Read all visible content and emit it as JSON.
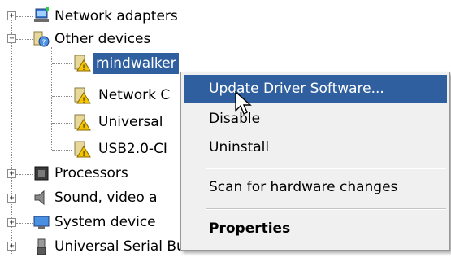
{
  "tree": {
    "nodes": [
      {
        "label": "Network adapters",
        "icon": "network-adapter-icon",
        "expander": "+"
      },
      {
        "label": "Other devices",
        "icon": "unknown-device-icon",
        "expander": "−"
      },
      {
        "label": "mindwalker",
        "icon": "warning-device-icon",
        "selected": true
      },
      {
        "label": "Network C",
        "icon": "warning-device-icon"
      },
      {
        "label": "Universal",
        "icon": "warning-device-icon"
      },
      {
        "label": "USB2.0-CI",
        "icon": "warning-device-icon"
      },
      {
        "label": "Processors",
        "icon": "processor-icon",
        "expander": "+"
      },
      {
        "label": "Sound, video a",
        "icon": "speaker-icon",
        "expander": "+"
      },
      {
        "label": "System device",
        "icon": "system-device-icon",
        "expander": "+"
      },
      {
        "label": "Universal Serial Bus controllers",
        "icon": "usb-icon",
        "expander": "+"
      }
    ]
  },
  "context_menu": {
    "items": [
      {
        "label": "Update Driver Software...",
        "highlighted": true
      },
      {
        "label": "Disable"
      },
      {
        "label": "Uninstall"
      },
      {
        "label": "Scan for hardware changes"
      },
      {
        "label": "Properties",
        "bold": true
      }
    ]
  },
  "colors": {
    "selection": "#2f5f9f",
    "warning": "#f5c400",
    "menu_background": "#f0f0f0"
  }
}
